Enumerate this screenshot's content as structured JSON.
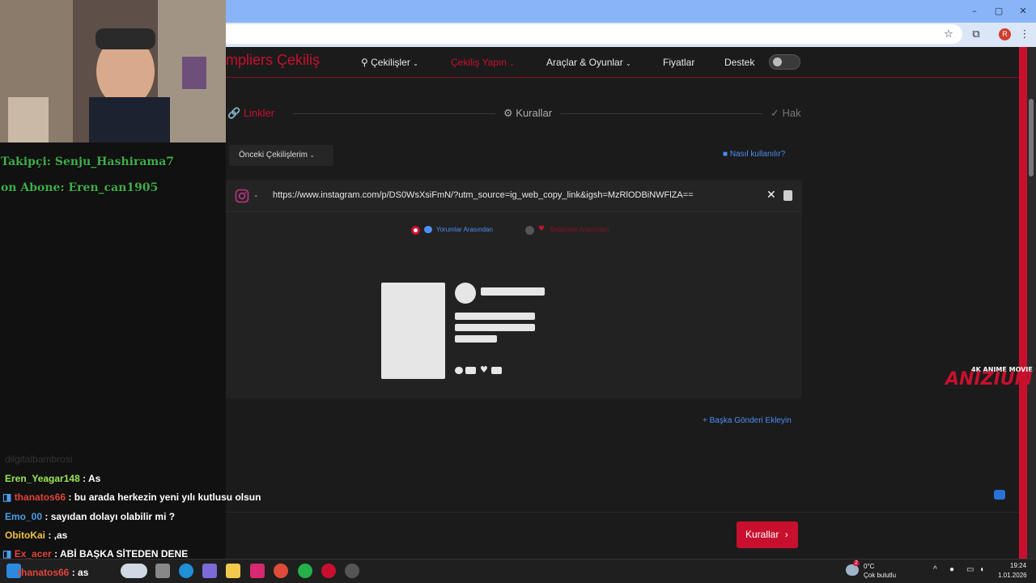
{
  "browser": {
    "window_controls": [
      "–",
      "▢",
      "✕"
    ],
    "profile_initial": "R"
  },
  "site": {
    "brand_part": "mpliers",
    "brand_title": "Çekiliş",
    "nav": [
      {
        "label": "Çekilişler",
        "active": false
      },
      {
        "label": "Çekiliş Yapın",
        "active": true
      },
      {
        "label": "Araçlar & Oyunlar",
        "active": false
      },
      {
        "label": "Fiyatlar",
        "active": false
      },
      {
        "label": "Destek",
        "active": false
      }
    ]
  },
  "steps": [
    {
      "label": "Linkler",
      "state": "active"
    },
    {
      "label": "Kurallar",
      "state": "inactive"
    },
    {
      "label": "Hak",
      "state": "inactive"
    }
  ],
  "previous_giveaways_label": "Önceki Çekilişlerim",
  "how_to_use_label": "Nasıl kullanılır?",
  "url_input": {
    "value": "https://www.instagram.com/p/DS0WsXsiFmN/?utm_source=ig_web_copy_link&igsh=MzRlODBiNWFlZA=="
  },
  "source_options": [
    {
      "label": "Yorumlar Arasından",
      "selected": true,
      "color": "#4a8ff5"
    },
    {
      "label": "Beğeniler Arasından",
      "selected": false,
      "color": "#c8102e"
    }
  ],
  "add_post_label": "+ Başka Gönderi Ekleyin",
  "next_button_label": "Kurallar",
  "watermark": {
    "line1": "4K ANIME MOVIE",
    "line2": "ANIZIUM"
  },
  "stream": {
    "overlay_follower": "Takipçi: Senju_Hashirama7",
    "overlay_sub": "on Abone: Eren_can1905",
    "faded_line": "dilgitalbambrosi",
    "chat": [
      {
        "user": "Eren_Yeagar148",
        "msg": ": As",
        "color": "#9be55a"
      },
      {
        "user": "thanatos66",
        "msg": ": bu arada herkezin yeni yılı kutlusu olsun",
        "color": "#e0443a"
      },
      {
        "user": "Emo_00",
        "msg": ": sayıdan dolayı olabilir mi ?",
        "color": "#4a9de8"
      },
      {
        "user": "ObitoKai",
        "msg": ": ,as",
        "color": "#f0c040"
      },
      {
        "user": "Ex_acer",
        "msg": ": ABİ BAŞKA SİTEDEN DENE",
        "color": "#e0443a"
      },
      {
        "user": "thanatos66",
        "msg": ": as",
        "color": "#e0443a"
      }
    ]
  },
  "taskbar": {
    "weather_temp": "0°C",
    "weather_desc": "Çok bulutlu",
    "weather_badge": "2",
    "time": "19:24",
    "date": "1.01.2026"
  }
}
